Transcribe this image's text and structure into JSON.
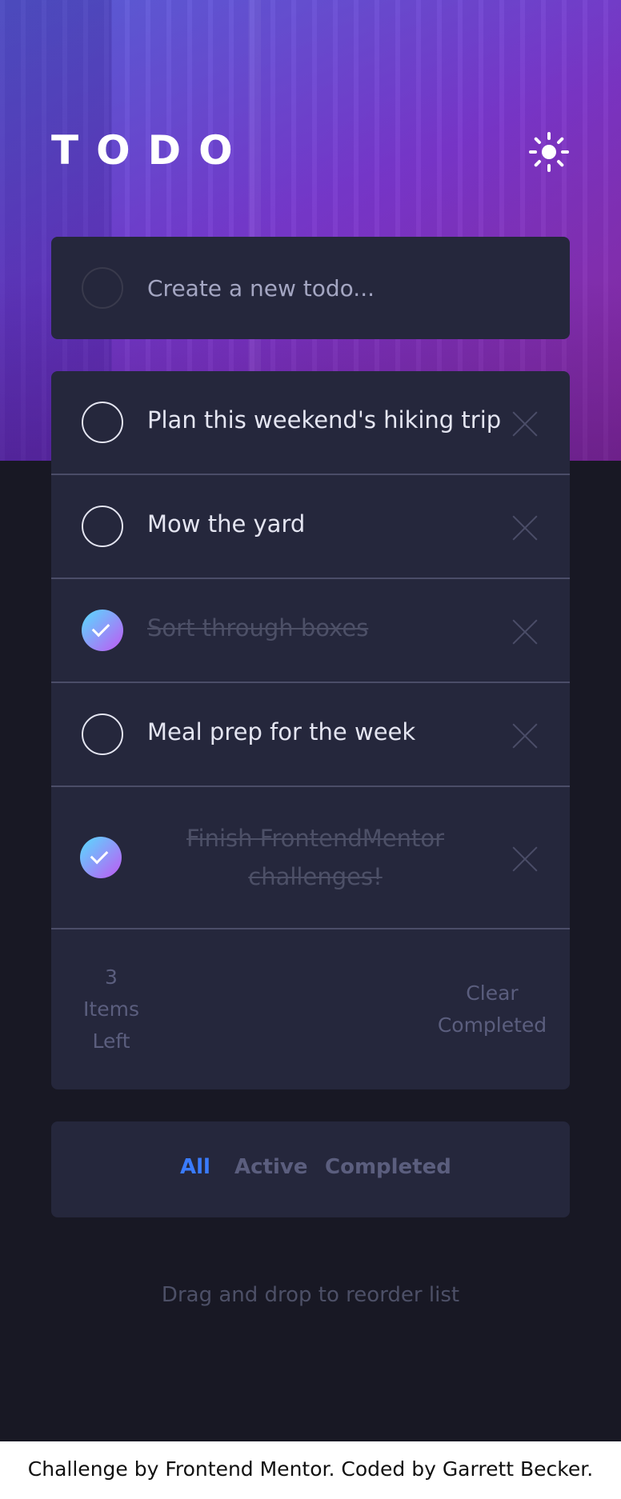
{
  "header": {
    "title": "TODO",
    "theme_toggle_icon": "sun-icon"
  },
  "new_todo": {
    "placeholder": "Create a new todo..."
  },
  "todos": [
    {
      "text": "Plan this weekend's hiking trip",
      "completed": false
    },
    {
      "text": "Mow the yard",
      "completed": false
    },
    {
      "text": "Sort through boxes",
      "completed": true
    },
    {
      "text": "Meal prep for the week",
      "completed": false
    },
    {
      "text": "Finish FrontendMentor challenges!",
      "completed": true
    }
  ],
  "footer": {
    "items_left_count": "3",
    "items_left_label_1": "Items",
    "items_left_label_2": "Left",
    "clear_label_1": "Clear",
    "clear_label_2": "Completed"
  },
  "filters": [
    {
      "label": "All",
      "active": true
    },
    {
      "label": "Active",
      "active": false
    },
    {
      "label": "Completed",
      "active": false
    }
  ],
  "hint": "Drag and drop to reorder list",
  "attribution": "Challenge by Frontend Mentor. Coded by Garrett Becker.",
  "colors": {
    "background": "#181824",
    "card": "#25273c",
    "accent": "#3a7bfd",
    "check_gradient_start": "#57ddff",
    "check_gradient_end": "#c058f3"
  }
}
